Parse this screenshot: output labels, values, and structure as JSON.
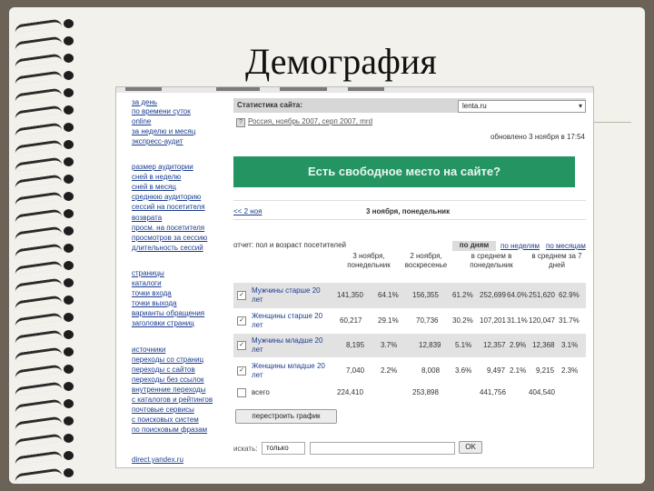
{
  "slide": {
    "title": "Демография"
  },
  "left_nav": {
    "items": [
      "за день",
      "по времени суток",
      "online",
      "за неделю и месяц",
      "экспресс-аудит",
      "размер аудитории",
      "сней в неделю",
      "сней в месяц",
      "среднюю аудиторию",
      "сессий на посетителя",
      "возврата",
      "просм. на посетителя",
      "просмотров за сессию",
      "длительность сессий",
      "страницы",
      "каталоги",
      "точки входа",
      "точки выхода",
      "варианты обращения",
      "заголовки страниц",
      "источники",
      "переходы со страниц",
      "переходы с сайтов",
      "переходы без ссылок",
      "внутренние переходы",
      "с каталогов и рейтингов",
      "почтовые сервисы",
      "с поисковых систем",
      "по поисковым фразам",
      "direct.yandex.ru"
    ]
  },
  "stats_site": {
    "label": "Статистика сайта:",
    "selected": "lenta.ru",
    "arrow": "▾"
  },
  "crumbs": {
    "help": "?",
    "text": "Россия, ноябрь 2007, серп 2007, mrd"
  },
  "updated": "обновлено 3 ноября в 17:54",
  "banner": "Есть свободное место на сайте?",
  "date_nav": {
    "prev": "<< 2 ноя",
    "current": "3 ноября, понедельник"
  },
  "report": {
    "label": "отчет: пол и возраст посетителей",
    "tab_active": "по дням",
    "tab_weeks": "по неделям",
    "tab_months": "по месяцам"
  },
  "table": {
    "headers": [
      "3 ноября, понедельник",
      "2 ноября, воскресенье",
      "в среднем в понедельник",
      "в среднем за 7 дней"
    ],
    "rows": [
      {
        "check": "✓",
        "label": "Мужчины старше 20 лет",
        "v1": "141,350",
        "p1": "64.1%",
        "v2": "156,355",
        "p2": "61.2%",
        "v3": "252,699",
        "p3": "64.0%",
        "v4": "251,620",
        "p4": "62.9%"
      },
      {
        "check": "✓",
        "label": "Женщины старше 20 лет",
        "v1": "60,217",
        "p1": "29.1%",
        "v2": "70,736",
        "p2": "30.2%",
        "v3": "107,201",
        "p3": "31.1%",
        "v4": "120,047",
        "p4": "31.7%"
      },
      {
        "check": "✓",
        "label": "Мужчины младше 20 лет",
        "v1": "8,195",
        "p1": "3.7%",
        "v2": "12,839",
        "p2": "5.1%",
        "v3": "12,357",
        "p3": "2.9%",
        "v4": "12,368",
        "p4": "3.1%"
      },
      {
        "check": "✓",
        "label": "Женщины младше 20 лет",
        "v1": "7,040",
        "p1": "2.2%",
        "v2": "8,008",
        "p2": "3.6%",
        "v3": "9,497",
        "p3": "2.1%",
        "v4": "9,215",
        "p4": "2.3%"
      }
    ],
    "total": {
      "label": "всего",
      "v1": "224,410",
      "v2": "253,898",
      "v3": "441,756",
      "v4": "404,540"
    }
  },
  "rebuild_button": "перестроить график",
  "bottom": {
    "label": "искать:",
    "select": "только",
    "ok": "OK"
  }
}
